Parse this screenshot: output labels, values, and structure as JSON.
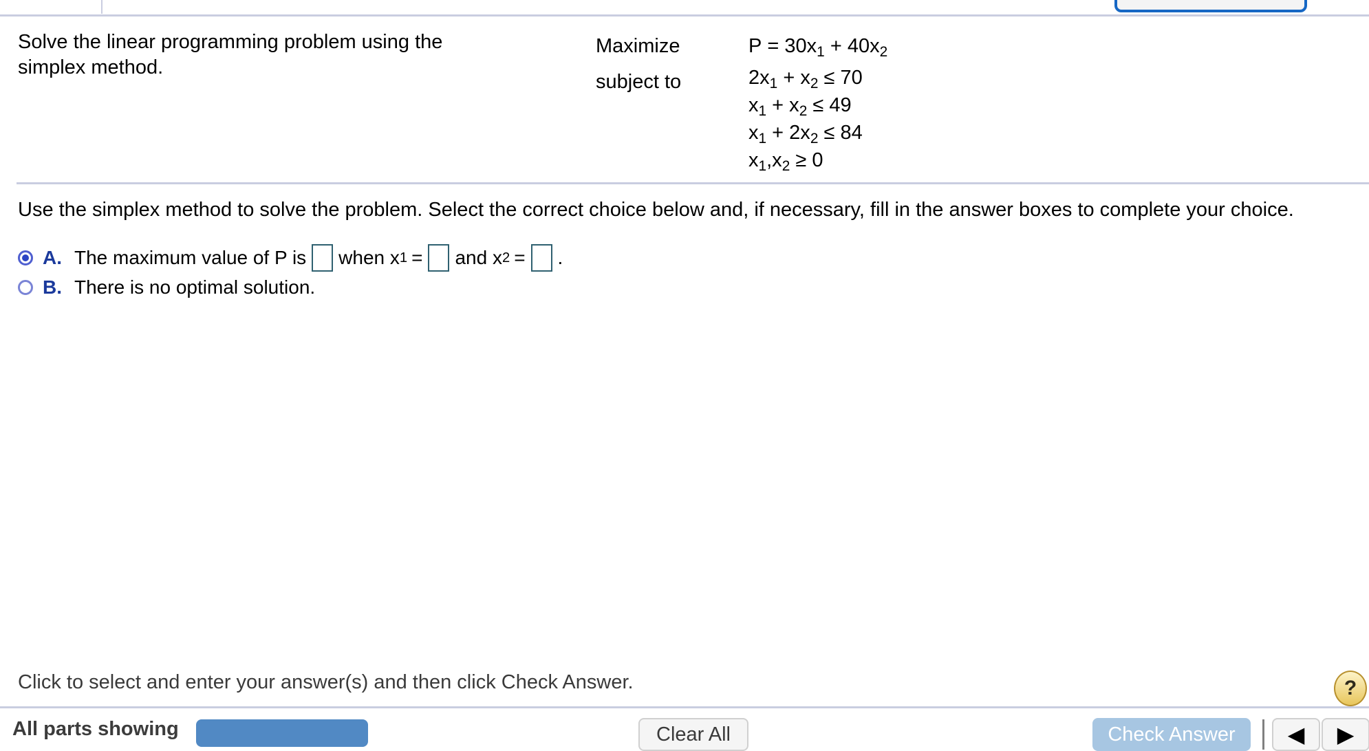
{
  "top_bar": {
    "cut_off_button_visible": true,
    "divider_color": "#c9cde0"
  },
  "problem": {
    "prompt": "Solve the linear programming problem using the simplex method.",
    "maximize_label": "Maximize",
    "subject_to_label": "subject to",
    "objective": {
      "lhs": "P",
      "eq": "=",
      "terms": "30x₁ + 40x₂",
      "plain": "P = 30x1 + 40x2"
    },
    "constraints": [
      {
        "plain": "2x1 + x2 ≤ 70"
      },
      {
        "plain": "x1 + x2 ≤ 49"
      },
      {
        "plain": "x1 + 2x2 ≤ 84"
      },
      {
        "plain": "x1,x2 ≥ 0"
      }
    ]
  },
  "question": {
    "text": "Use the simplex method to solve the problem. Select the correct choice below and, if necessary, fill in the answer boxes to complete your choice."
  },
  "choices": [
    {
      "letter": "A.",
      "selected": true,
      "segments": [
        "The maximum value of P is",
        "when x",
        "=",
        "and x",
        "=",
        "."
      ],
      "subs": [
        "1",
        "2"
      ],
      "inputs": [
        {
          "value": ""
        },
        {
          "value": ""
        },
        {
          "value": ""
        }
      ]
    },
    {
      "letter": "B.",
      "selected": false,
      "text": "There is no optimal solution."
    }
  ],
  "instruction": {
    "text": "Click to select and enter your answer(s) and then click Check Answer.",
    "help_glyph": "?"
  },
  "bottom_bar": {
    "all_parts_label": "All parts showing",
    "progress_color": "#5189c4",
    "clear_all_label": "Clear All",
    "check_answer_label": "Check Answer",
    "check_answer_color": "#a7c6e2",
    "prev_glyph": "◀",
    "next_glyph": "▶"
  },
  "colors": {
    "choice_letter": "#1b3a9c",
    "radio_selected": "#2b44c4",
    "answer_box_border": "#2f6070",
    "divider": "#c9cde0",
    "help_button": "#e8c65c"
  }
}
